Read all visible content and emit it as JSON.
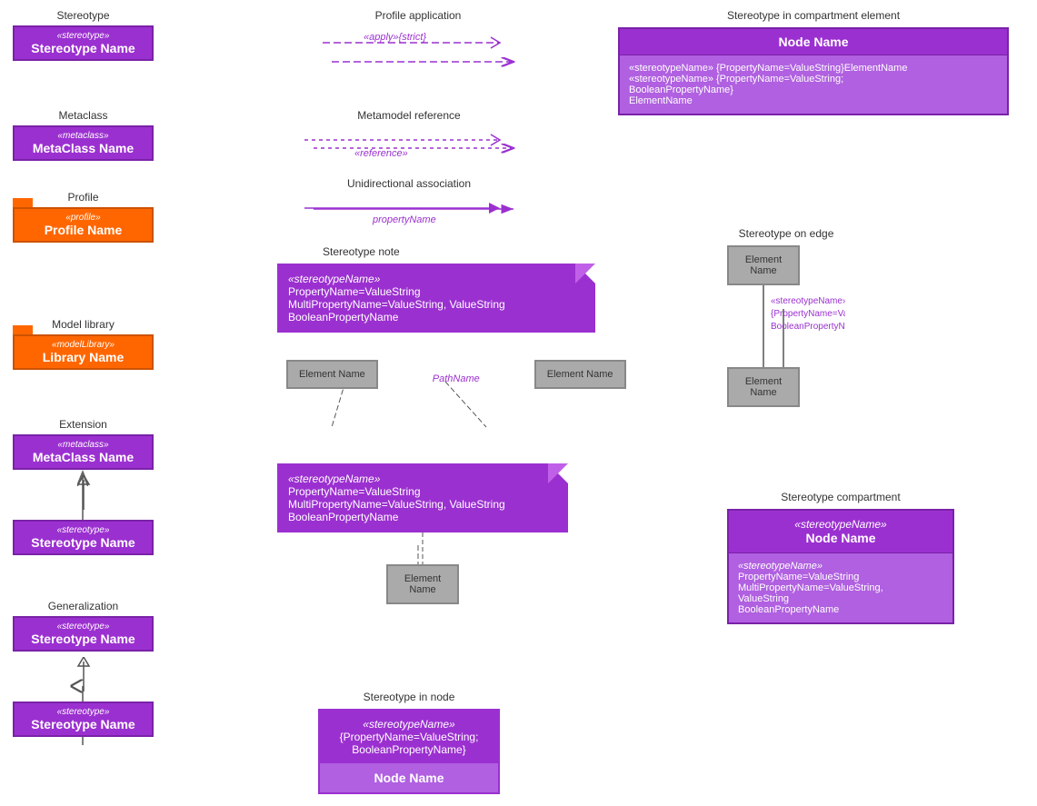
{
  "sections": {
    "stereotype": {
      "label": "Stereotype",
      "keyword": "«stereotype»",
      "name": "Stereotype Name"
    },
    "metaclass": {
      "label": "Metaclass",
      "keyword": "«metaclass»",
      "name": "MetaClass Name"
    },
    "profile": {
      "label": "Profile",
      "keyword": "«profile»",
      "name": "Profile Name"
    },
    "model_library": {
      "label": "Model library",
      "keyword": "«modelLibrary»",
      "name": "Library Name"
    },
    "extension": {
      "label": "Extension",
      "metaclass_keyword": "«metaclass»",
      "metaclass_name": "MetaClass Name",
      "stereotype_keyword": "«stereotype»",
      "stereotype_name": "Stereotype Name"
    },
    "generalization": {
      "label": "Generalization",
      "top_keyword": "«stereotype»",
      "top_name": "Stereotype Name",
      "bottom_keyword": "«stereotype»",
      "bottom_name": "Stereotype Name"
    }
  },
  "profile_application": {
    "label": "Profile application",
    "arrow_text": "«apply»{strict}"
  },
  "metamodel_reference": {
    "label": "Metamodel reference",
    "arrow_text": "«reference»"
  },
  "unidirectional": {
    "label": "Unidirectional association",
    "arrow_text": "propertyName"
  },
  "stereotype_note": {
    "label": "Stereotype note",
    "line1": "«stereotypeName»",
    "line2": "PropertyName=ValueString",
    "line3": "MultiPropertyName=ValueString, ValueString",
    "line4": "BooleanPropertyName",
    "element1": "Element\nName",
    "element2": "Element\nName",
    "path_label": "PathName"
  },
  "stereotype_note2": {
    "line1": "«stereotypeName»",
    "line2": "PropertyName=ValueString",
    "line3": "MultiPropertyName=ValueString, ValueString",
    "line4": "BooleanPropertyName",
    "element": "Element\nName"
  },
  "stereotype_in_node": {
    "label": "Stereotype in node",
    "keyword_line1": "«stereotypeName»",
    "keyword_line2": "{PropertyName=ValueString;",
    "keyword_line3": "BooleanPropertyName}",
    "name": "Node Name"
  },
  "stereotype_compartment_element": {
    "label": "Stereotype in compartment element",
    "node_name": "Node Name",
    "body_line1": "«stereotypeName» {PropertyName=ValueString}ElementName",
    "body_line2": "«stereotypeName» {PropertyName=ValueString;",
    "body_line3": "BooleanPropertyName}",
    "body_line4": "ElementName"
  },
  "stereotype_on_edge": {
    "label": "Stereotype on edge",
    "element1": "Element\nName",
    "element2": "Element\nName",
    "edge_line1": "«stereotypeName»",
    "edge_line2": "{PropertyName=ValueString;",
    "edge_line3": "BooleanPropertyName}PathName"
  },
  "stereotype_compartment": {
    "label": "Stereotype compartment",
    "header_line1": "«stereotypeName»",
    "header_line2": "Node Name",
    "body_line1": "«stereotypeName»",
    "body_line2": "PropertyName=ValueString",
    "body_line3": "MultiPropertyName=ValueString,",
    "body_line4": "ValueString",
    "body_line5": "BooleanPropertyName"
  }
}
